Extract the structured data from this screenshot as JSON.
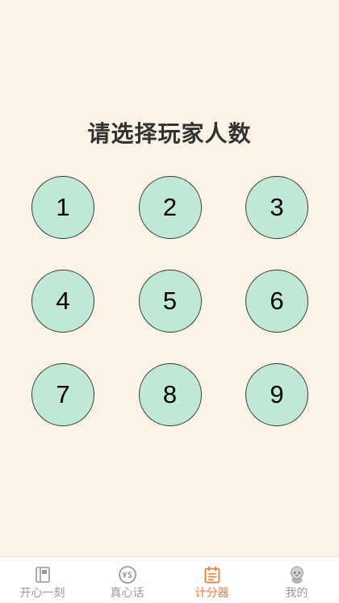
{
  "title": "请选择玩家人数",
  "options": [
    "1",
    "2",
    "3",
    "4",
    "5",
    "6",
    "7",
    "8",
    "9"
  ],
  "tabs": [
    {
      "label": "开心一刻",
      "icon": "notebook-icon",
      "active": false
    },
    {
      "label": "真心话",
      "icon": "vs-icon",
      "active": false
    },
    {
      "label": "计分器",
      "icon": "clipboard-icon",
      "active": true
    },
    {
      "label": "我的",
      "icon": "avatar-icon",
      "active": false
    }
  ],
  "colors": {
    "background": "#FAF3E6",
    "circle_fill": "#C0E8D6",
    "active_tab": "#F07A2E",
    "inactive_tab": "#9A9A9A"
  }
}
